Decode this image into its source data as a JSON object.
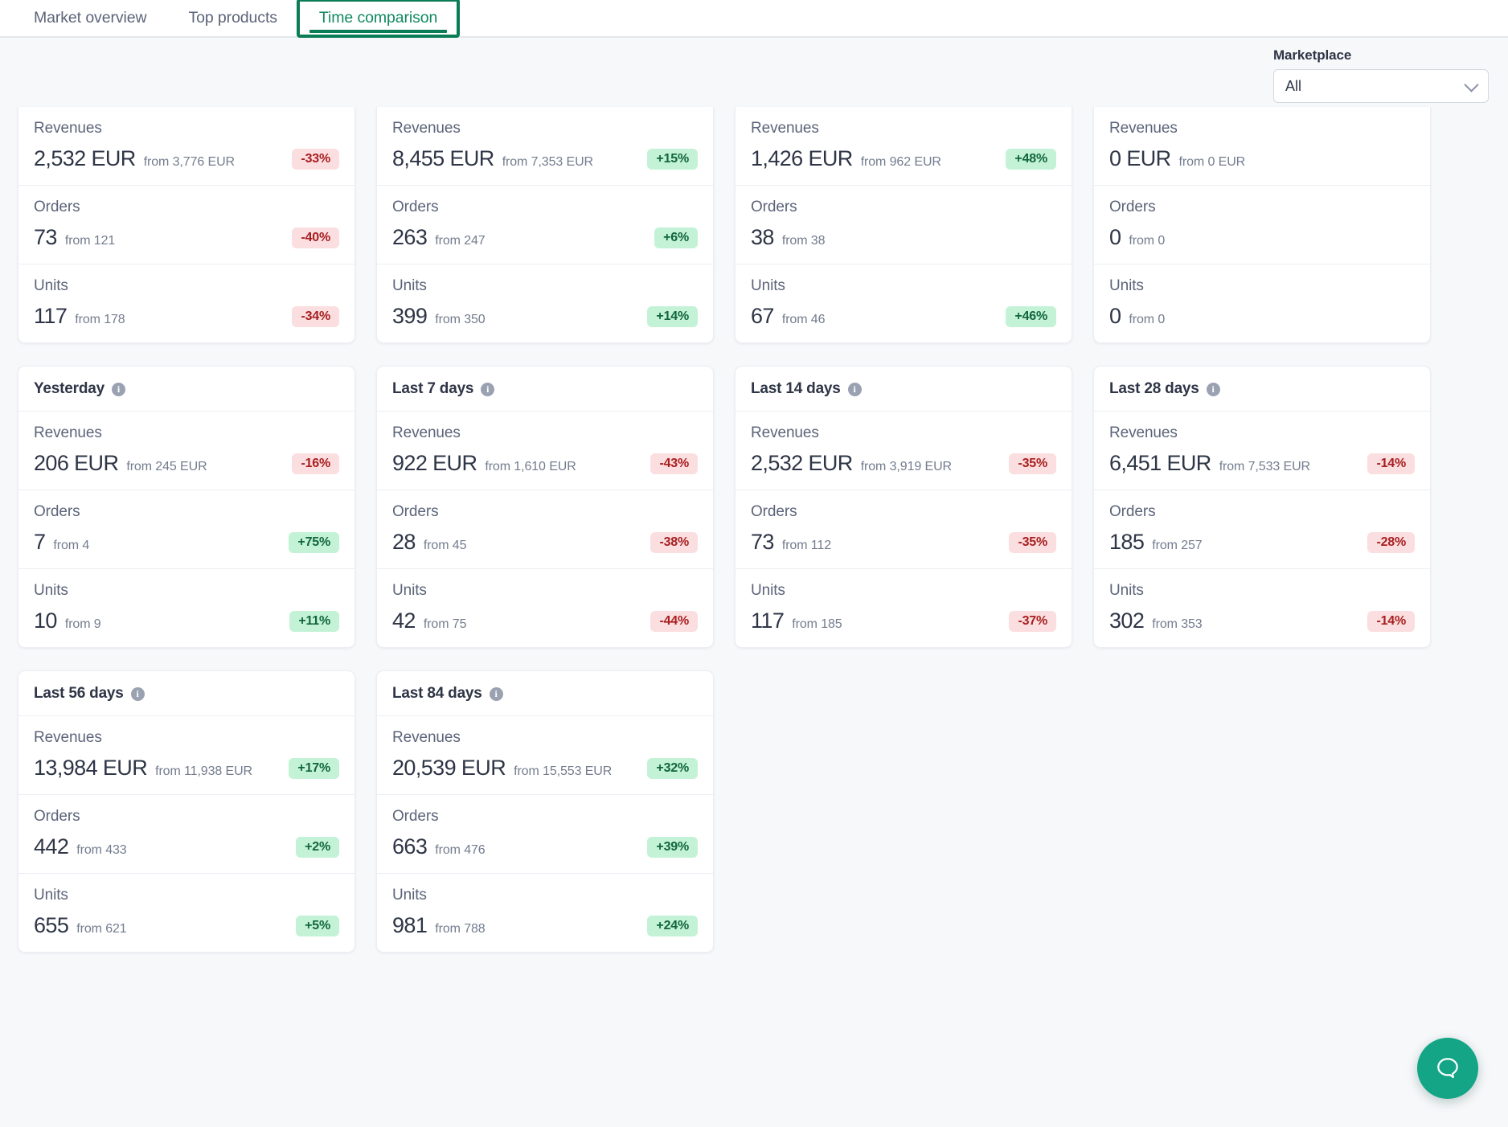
{
  "tabs": [
    {
      "label": "Market overview",
      "active": false
    },
    {
      "label": "Top products",
      "active": false
    },
    {
      "label": "Time comparison",
      "active": true
    }
  ],
  "filters": {
    "marketplace_label": "Marketplace",
    "marketplace_value": "All",
    "chevron_icon": "chevron-down-icon"
  },
  "metric_labels": {
    "revenues": "Revenues",
    "orders": "Orders",
    "units": "Units"
  },
  "info_icon_glyph": "i",
  "colors": {
    "accent_green": "#0b7d55",
    "badge_positive_bg": "#c3f2d6",
    "badge_positive_text": "#11663d",
    "badge_negative_bg": "#fbdedf",
    "badge_negative_text": "#a81e20",
    "chat_button": "#13a586",
    "page_background": "#f7f8fa"
  },
  "chat_button": {
    "icon": "chat-bubble-icon"
  },
  "cards": [
    {
      "title": null,
      "clipped": true,
      "has_info": false,
      "metrics": [
        {
          "label": "Revenues",
          "value": "2,532 EUR",
          "from": "from 3,776 EUR",
          "badge": "-33%",
          "badge_kind": "neg"
        },
        {
          "label": "Orders",
          "value": "73",
          "from": "from 121",
          "badge": "-40%",
          "badge_kind": "neg"
        },
        {
          "label": "Units",
          "value": "117",
          "from": "from 178",
          "badge": "-34%",
          "badge_kind": "neg"
        }
      ]
    },
    {
      "title": null,
      "clipped": true,
      "has_info": false,
      "metrics": [
        {
          "label": "Revenues",
          "value": "8,455 EUR",
          "from": "from 7,353 EUR",
          "badge": "+15%",
          "badge_kind": "pos"
        },
        {
          "label": "Orders",
          "value": "263",
          "from": "from 247",
          "badge": "+6%",
          "badge_kind": "pos"
        },
        {
          "label": "Units",
          "value": "399",
          "from": "from 350",
          "badge": "+14%",
          "badge_kind": "pos"
        }
      ]
    },
    {
      "title": null,
      "clipped": true,
      "has_info": false,
      "metrics": [
        {
          "label": "Revenues",
          "value": "1,426 EUR",
          "from": "from 962 EUR",
          "badge": "+48%",
          "badge_kind": "pos"
        },
        {
          "label": "Orders",
          "value": "38",
          "from": "from 38",
          "badge": "",
          "badge_kind": "empty"
        },
        {
          "label": "Units",
          "value": "67",
          "from": "from 46",
          "badge": "+46%",
          "badge_kind": "pos"
        }
      ]
    },
    {
      "title": null,
      "clipped": true,
      "has_info": false,
      "metrics": [
        {
          "label": "Revenues",
          "value": "0 EUR",
          "from": "from 0 EUR",
          "badge": "",
          "badge_kind": "empty"
        },
        {
          "label": "Orders",
          "value": "0",
          "from": "from 0",
          "badge": "",
          "badge_kind": "empty"
        },
        {
          "label": "Units",
          "value": "0",
          "from": "from 0",
          "badge": "",
          "badge_kind": "empty"
        }
      ]
    },
    {
      "title": "Yesterday",
      "clipped": false,
      "has_info": true,
      "metrics": [
        {
          "label": "Revenues",
          "value": "206 EUR",
          "from": "from 245 EUR",
          "badge": "-16%",
          "badge_kind": "neg"
        },
        {
          "label": "Orders",
          "value": "7",
          "from": "from 4",
          "badge": "+75%",
          "badge_kind": "pos"
        },
        {
          "label": "Units",
          "value": "10",
          "from": "from 9",
          "badge": "+11%",
          "badge_kind": "pos"
        }
      ]
    },
    {
      "title": "Last 7 days",
      "clipped": false,
      "has_info": true,
      "metrics": [
        {
          "label": "Revenues",
          "value": "922 EUR",
          "from": "from 1,610 EUR",
          "badge": "-43%",
          "badge_kind": "neg"
        },
        {
          "label": "Orders",
          "value": "28",
          "from": "from 45",
          "badge": "-38%",
          "badge_kind": "neg"
        },
        {
          "label": "Units",
          "value": "42",
          "from": "from 75",
          "badge": "-44%",
          "badge_kind": "neg"
        }
      ]
    },
    {
      "title": "Last 14 days",
      "clipped": false,
      "has_info": true,
      "metrics": [
        {
          "label": "Revenues",
          "value": "2,532 EUR",
          "from": "from 3,919 EUR",
          "badge": "-35%",
          "badge_kind": "neg"
        },
        {
          "label": "Orders",
          "value": "73",
          "from": "from 112",
          "badge": "-35%",
          "badge_kind": "neg"
        },
        {
          "label": "Units",
          "value": "117",
          "from": "from 185",
          "badge": "-37%",
          "badge_kind": "neg"
        }
      ]
    },
    {
      "title": "Last 28 days",
      "clipped": false,
      "has_info": true,
      "metrics": [
        {
          "label": "Revenues",
          "value": "6,451 EUR",
          "from": "from 7,533 EUR",
          "badge": "-14%",
          "badge_kind": "neg"
        },
        {
          "label": "Orders",
          "value": "185",
          "from": "from 257",
          "badge": "-28%",
          "badge_kind": "neg"
        },
        {
          "label": "Units",
          "value": "302",
          "from": "from 353",
          "badge": "-14%",
          "badge_kind": "neg"
        }
      ]
    },
    {
      "title": "Last 56 days",
      "clipped": false,
      "has_info": true,
      "metrics": [
        {
          "label": "Revenues",
          "value": "13,984 EUR",
          "from": "from 11,938 EUR",
          "badge": "+17%",
          "badge_kind": "pos"
        },
        {
          "label": "Orders",
          "value": "442",
          "from": "from 433",
          "badge": "+2%",
          "badge_kind": "pos"
        },
        {
          "label": "Units",
          "value": "655",
          "from": "from 621",
          "badge": "+5%",
          "badge_kind": "pos"
        }
      ]
    },
    {
      "title": "Last 84 days",
      "clipped": false,
      "has_info": true,
      "metrics": [
        {
          "label": "Revenues",
          "value": "20,539 EUR",
          "from": "from 15,553 EUR",
          "badge": "+32%",
          "badge_kind": "pos"
        },
        {
          "label": "Orders",
          "value": "663",
          "from": "from 476",
          "badge": "+39%",
          "badge_kind": "pos"
        },
        {
          "label": "Units",
          "value": "981",
          "from": "from 788",
          "badge": "+24%",
          "badge_kind": "pos"
        }
      ]
    }
  ]
}
